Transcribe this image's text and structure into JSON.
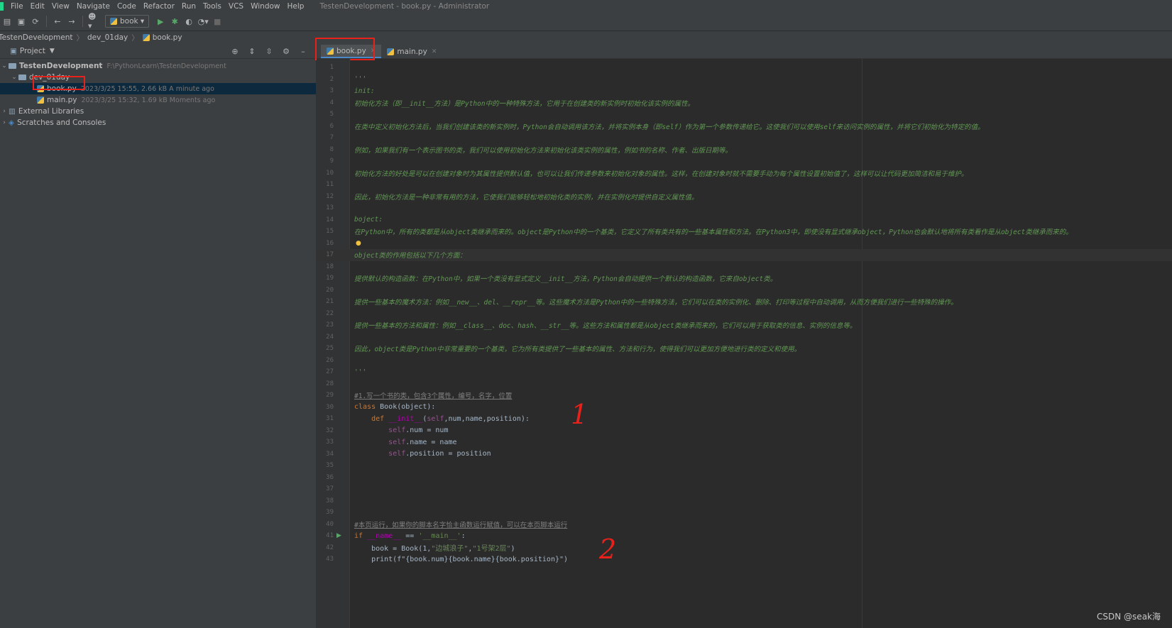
{
  "window_title": "TestenDevelopment - book.py - Administrator",
  "menu": [
    "File",
    "Edit",
    "View",
    "Navigate",
    "Code",
    "Refactor",
    "Run",
    "Tools",
    "VCS",
    "Window",
    "Help"
  ],
  "toolbar": {
    "run_config": "book"
  },
  "breadcrumb": [
    "TestenDevelopment",
    "dev_01day",
    "book.py"
  ],
  "project_panel": {
    "title": "Project",
    "root": {
      "name": "TestenDevelopment",
      "path": "F:\\PythonLearn\\TestenDevelopment"
    },
    "folder": "dev_01day",
    "files": [
      {
        "name": "book.py",
        "meta": "2023/3/25 15:55, 2.66 kB A minute ago"
      },
      {
        "name": "main.py",
        "meta": "2023/3/25 15:32, 1.69 kB Moments ago"
      }
    ],
    "external": "External Libraries",
    "scratches": "Scratches and Consoles"
  },
  "tabs": [
    {
      "name": "book.py",
      "active": true
    },
    {
      "name": "main.py",
      "active": false
    }
  ],
  "code_lines": [
    {
      "n": "1",
      "t": "",
      "c": "plain"
    },
    {
      "n": "2",
      "t": "'''",
      "c": "doc"
    },
    {
      "n": "3",
      "t": "init:",
      "c": "doc"
    },
    {
      "n": "4",
      "t": "初始化方法（即__init__方法）是Python中的一种特殊方法，它用于在创建类的新实例时初始化该实例的属性。",
      "c": "doc"
    },
    {
      "n": "5",
      "t": "",
      "c": "plain"
    },
    {
      "n": "6",
      "t": "在类中定义初始化方法后，当我们创建该类的新实例时，Python会自动调用该方法，并将实例本身（即self）作为第一个参数传递给它。这使我们可以使用self来访问实例的属性，并将它们初始化为特定的值。",
      "c": "doc"
    },
    {
      "n": "7",
      "t": "",
      "c": "plain"
    },
    {
      "n": "8",
      "t": "例如，如果我们有一个表示图书的类，我们可以使用初始化方法来初始化该类实例的属性，例如书的名称、作者、出版日期等。",
      "c": "doc"
    },
    {
      "n": "9",
      "t": "",
      "c": "plain"
    },
    {
      "n": "10",
      "t": "初始化方法的好处是可以在创建对象时为其属性提供默认值，也可以让我们传递参数来初始化对象的属性。这样，在创建对象时就不需要手动为每个属性设置初始值了，这样可以让代码更加简洁和易于维护。",
      "c": "doc"
    },
    {
      "n": "11",
      "t": "",
      "c": "plain"
    },
    {
      "n": "12",
      "t": "因此，初始化方法是一种非常有用的方法，它使我们能够轻松地初始化类的实例，并在实例化时提供自定义属性值。",
      "c": "doc"
    },
    {
      "n": "13",
      "t": "",
      "c": "plain"
    },
    {
      "n": "14",
      "t": "boject:",
      "c": "doc"
    },
    {
      "n": "15",
      "t": "在Python中，所有的类都是从object类继承而来的。object是Python中的一个基类，它定义了所有类共有的一些基本属性和方法。在Python3中，即使没有显式继承object，Python也会默认地将所有类看作是从object类继承而来的。",
      "c": "doc"
    },
    {
      "n": "16",
      "t": "",
      "c": "plain"
    },
    {
      "n": "17",
      "t": "object类的作用包括以下几个方面：",
      "c": "doc"
    },
    {
      "n": "18",
      "t": "",
      "c": "plain"
    },
    {
      "n": "19",
      "t": "提供默认的构造函数：在Python中，如果一个类没有显式定义__init__方法，Python会自动提供一个默认的构造函数，它来自object类。",
      "c": "doc"
    },
    {
      "n": "20",
      "t": "",
      "c": "plain"
    },
    {
      "n": "21",
      "t": "提供一些基本的魔术方法：例如__new__、del、__repr__等。这些魔术方法是Python中的一些特殊方法，它们可以在类的实例化、删除、打印等过程中自动调用，从而方便我们进行一些特殊的操作。",
      "c": "doc"
    },
    {
      "n": "22",
      "t": "",
      "c": "plain"
    },
    {
      "n": "23",
      "t": "提供一些基本的方法和属性：例如__class__、doc、hash、__str__等。这些方法和属性都是从object类继承而来的，它们可以用于获取类的信息、实例的信息等。",
      "c": "doc"
    },
    {
      "n": "24",
      "t": "",
      "c": "plain"
    },
    {
      "n": "25",
      "t": "因此，object类是Python中非常重要的一个基类，它为所有类提供了一些基本的属性、方法和行为，使得我们可以更加方便地进行类的定义和使用。",
      "c": "doc"
    },
    {
      "n": "26",
      "t": "",
      "c": "plain"
    },
    {
      "n": "27",
      "t": "'''",
      "c": "doc"
    },
    {
      "n": "28",
      "t": "",
      "c": "plain"
    },
    {
      "n": "29",
      "t": "#1.写一个书的类，包含3个属性，编号，名字，位置",
      "c": "cmt"
    },
    {
      "n": "30",
      "t": "class Book(object):",
      "c": "mix_class"
    },
    {
      "n": "31",
      "t": "    def __init__(self,num,name,position):",
      "c": "mix_def"
    },
    {
      "n": "32",
      "t": "        self.num = num",
      "c": "mix_self"
    },
    {
      "n": "33",
      "t": "        self.name = name",
      "c": "mix_self"
    },
    {
      "n": "34",
      "t": "        self.position = position",
      "c": "mix_self"
    },
    {
      "n": "35",
      "t": "",
      "c": "plain"
    },
    {
      "n": "36",
      "t": "",
      "c": "plain"
    },
    {
      "n": "37",
      "t": "",
      "c": "plain"
    },
    {
      "n": "38",
      "t": "",
      "c": "plain"
    },
    {
      "n": "39",
      "t": "",
      "c": "plain"
    },
    {
      "n": "40",
      "t": "#本页运行，如果你的脚本名字恰主函数运行赋值，可以在本页脚本运行",
      "c": "cmt"
    },
    {
      "n": "41",
      "t": "if __name__ == '__main__':",
      "c": "mix_if"
    },
    {
      "n": "42",
      "t": "    book = Book(1,\"边城浪子\",\"1号架2层\")",
      "c": "mix_book"
    },
    {
      "n": "43",
      "t": "    print(f\"{book.num}{book.name}{book.position}\")",
      "c": "plain"
    }
  ],
  "annotations": [
    "1",
    "2"
  ],
  "watermark": "CSDN @seak海"
}
